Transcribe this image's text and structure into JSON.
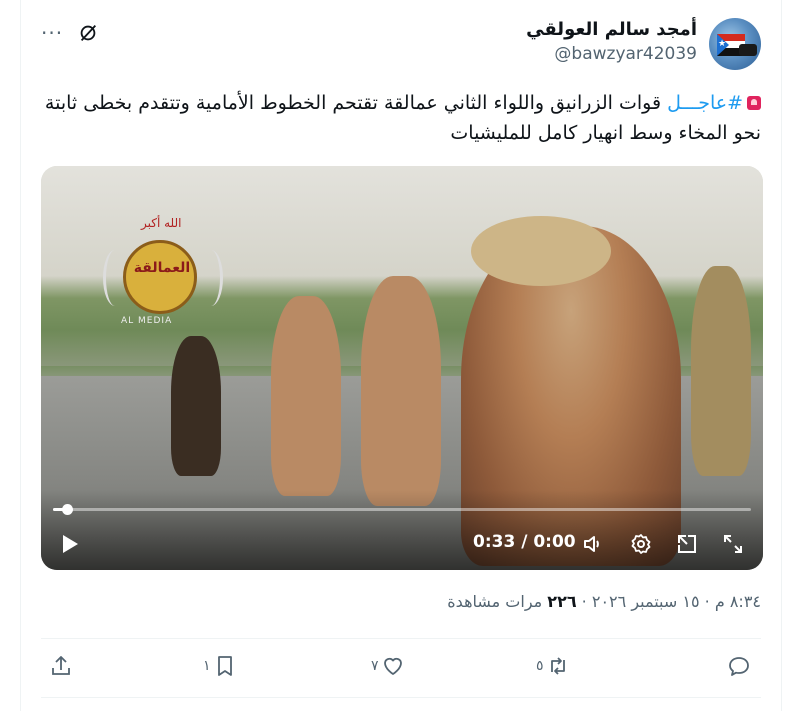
{
  "tweet": {
    "author": {
      "display_name": "أمجد سالم العولقي",
      "handle": "@bawzyar42039",
      "avatar_icon": "avatar-flag-image"
    },
    "header_icons": {
      "grok_icon": "grok-slash-icon",
      "more_label": "···"
    },
    "text": {
      "emoji": "alarm-emoji",
      "hashtag": "#عاجـــل",
      "body": " قوات الزرانيق واللواء الثاني عمالقة تقتحم الخطوط الأمامية وتتقدم بخطى ثابتة نحو المخاء وسط انهيار كامل للمليشيات"
    },
    "video": {
      "time_display": "0:33 / 0:00",
      "progress_fraction": 0.02,
      "logo_text_top": "الله أكبر",
      "logo_text_main": "العمالقة",
      "logo_text_bottom": "AL MEDIA",
      "icons": [
        "play-icon",
        "volume-icon",
        "settings-icon",
        "picture-in-picture-icon",
        "fullscreen-icon"
      ]
    },
    "meta": {
      "time": "٨:٣٤ م",
      "separator": " · ",
      "date": "١٥ سبتمبر ٢٠٢٦",
      "views_count": "٢٢٦",
      "views_label": " مرات مشاهدة"
    },
    "actions": {
      "reply_count": "",
      "retweet_count": "٥",
      "like_count": "٧",
      "bookmark_count": "١",
      "share_label": ""
    }
  }
}
